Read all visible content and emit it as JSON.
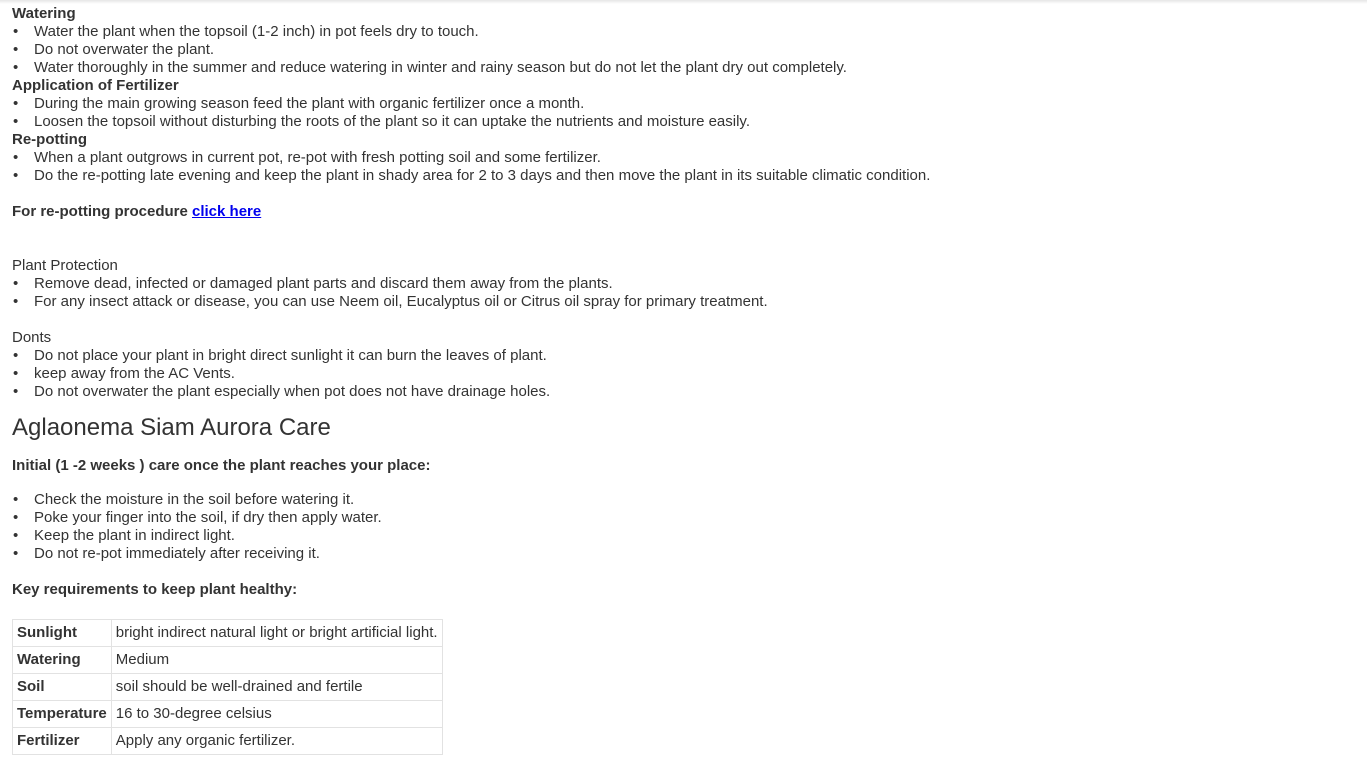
{
  "sections": {
    "watering": {
      "title": "Watering",
      "items": [
        "Water the plant when the topsoil (1-2 inch) in pot feels dry to touch.",
        "Do not overwater the plant.",
        "Water thoroughly in the summer and reduce watering in winter and rainy season but do not let the plant dry out completely."
      ]
    },
    "fertilizer": {
      "title": "Application of Fertilizer",
      "items": [
        "During the main growing season feed the plant with organic fertilizer once a month.",
        "Loosen the topsoil without disturbing the roots of the plant so it can uptake the nutrients and moisture easily."
      ]
    },
    "repotting": {
      "title": "Re-potting",
      "items": [
        "When a plant outgrows in current pot, re-pot with fresh potting soil and some fertilizer.",
        "Do the re-potting late evening and keep the plant in shady area for 2 to 3 days and then move the plant in its suitable climatic condition."
      ],
      "procedure_text": "For re-potting procedure ",
      "procedure_link": "click here"
    },
    "protection": {
      "title": "Plant Protection",
      "items": [
        "Remove dead, infected or damaged plant parts and discard them away from the plants.",
        "For any insect attack or disease, you can use Neem oil, Eucalyptus oil or Citrus oil spray for primary treatment."
      ]
    },
    "donts": {
      "title": "Donts",
      "items": [
        "Do not place your plant in bright direct sunlight it can burn the leaves of plant.",
        "keep away from the AC Vents.",
        "Do not overwater the plant especially when pot does not have drainage holes."
      ]
    }
  },
  "care": {
    "heading": "Aglaonema Siam Aurora Care",
    "initial_title": "Initial (1 -2 weeks ) care once the plant reaches your place:",
    "initial_items": [
      "Check the moisture in the soil before watering it.",
      "Poke your finger into the soil, if dry then apply water.",
      "Keep the plant in indirect light.",
      "Do not re-pot immediately after receiving it."
    ],
    "key_title": "Key requirements to keep plant healthy:",
    "table": [
      {
        "label": "Sunlight",
        "value": "bright indirect natural light or bright artificial light."
      },
      {
        "label": "Watering",
        "value": "Medium"
      },
      {
        "label": "Soil",
        "value": "soil should be well-drained and fertile"
      },
      {
        "label": "Temperature",
        "value": "16 to 30-degree celsius"
      },
      {
        "label": "Fertilizer",
        "value": "Apply any organic fertilizer."
      }
    ]
  }
}
